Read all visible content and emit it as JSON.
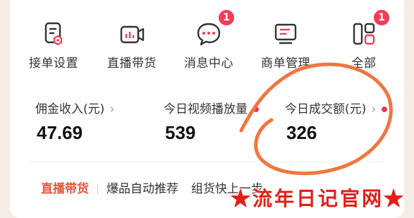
{
  "shortcuts": [
    {
      "label": "接单设置",
      "icon": "order-settings-icon"
    },
    {
      "label": "直播带货",
      "icon": "live-video-icon"
    },
    {
      "label": "消息中心",
      "icon": "message-icon",
      "badge": "1"
    },
    {
      "label": "商单管理",
      "icon": "business-order-icon"
    },
    {
      "label": "全部",
      "icon": "all-apps-icon",
      "badge": "1"
    }
  ],
  "stats": [
    {
      "label": "佣金收入(元)",
      "value": "47.69"
    },
    {
      "label": "今日视频播放量",
      "value": "539"
    },
    {
      "label": "今日成交额(元)",
      "value": "326"
    }
  ],
  "tabs": {
    "active": "直播带货",
    "items": [
      "爆品自动推荐",
      "组货快上一步"
    ]
  },
  "watermark": "★流年日记官网★",
  "colors": {
    "accent": "#e8533b",
    "badge": "#f23d55",
    "annotation": "#f0763f"
  }
}
